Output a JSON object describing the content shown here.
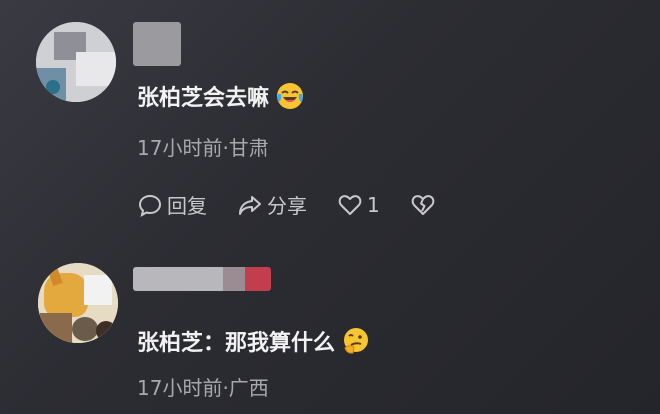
{
  "comments": [
    {
      "text": "张柏芝会去嘛",
      "emoji": "laughing-crying-emoji",
      "meta": "17小时前·甘肃",
      "actions": {
        "reply": "回复",
        "share": "分享",
        "like_count": "1"
      }
    },
    {
      "text": "张柏芝：那我算什么",
      "emoji": "thinking-emoji",
      "meta": "17小时前·广西"
    }
  ],
  "colors": {
    "background": "#2c2d33",
    "text_primary": "#f2f2f2",
    "text_secondary": "#a9a9ad",
    "icon": "#c9c9cc"
  }
}
